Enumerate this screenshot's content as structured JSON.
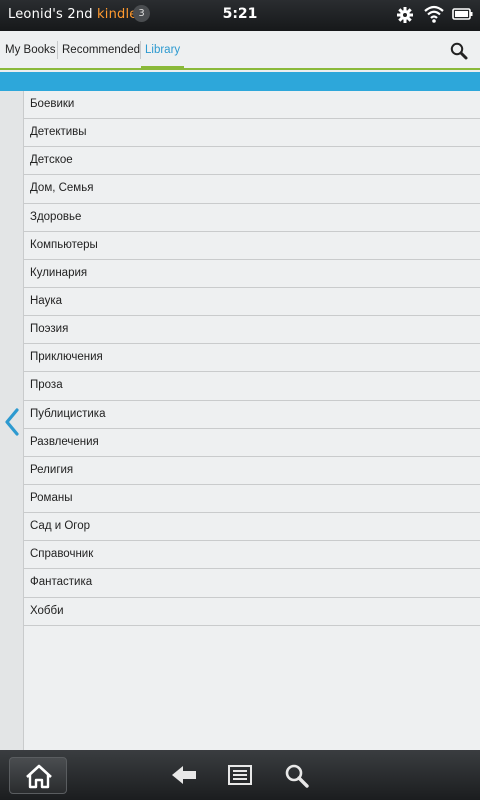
{
  "status_bar": {
    "device_name_prefix": "Leonid's 2nd ",
    "device_name_accent": "kindle",
    "notification_count": "3",
    "time": "5:21",
    "icons": [
      "gear-icon",
      "wifi-icon",
      "battery-icon"
    ]
  },
  "tabs": [
    {
      "label": "My Books",
      "active": false
    },
    {
      "label": "Recommended",
      "active": false
    },
    {
      "label": "Library",
      "active": true
    }
  ],
  "categories": [
    "Боевики",
    "Детективы",
    "Детское",
    "Дом, Семья",
    "Здоровье",
    "Компьютеры",
    "Кулинария",
    "Наука",
    "Поэзия",
    "Приключения",
    "Проза",
    "Публицистика",
    "Развлечения",
    "Религия",
    "Романы",
    "Сад и Огор",
    "Справочник",
    "Фантастика",
    "Хобби"
  ],
  "bottom_nav": [
    "home-icon",
    "back-icon",
    "menu-icon",
    "search-icon"
  ],
  "colors": {
    "accent_orange": "#ff9a2f",
    "tab_active_blue": "#2d9ad0",
    "tab_underline_green": "#8ab93a",
    "band_blue": "#2da7da"
  }
}
